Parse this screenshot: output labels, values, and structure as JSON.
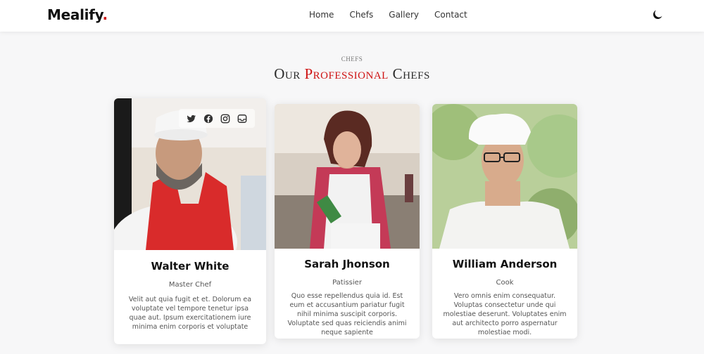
{
  "brand": {
    "name": "Mealify",
    "dot": "."
  },
  "nav": {
    "items": [
      "Home",
      "Chefs",
      "Gallery",
      "Contact"
    ]
  },
  "section": {
    "subtitle": "CHEFS",
    "title_part1": "Our ",
    "title_accent": "Professional",
    "title_part2": " Chefs"
  },
  "chefs": [
    {
      "name": "Walter White",
      "role": "Master Chef",
      "description": "Velit aut quia fugit et et. Dolorum ea voluptate vel tempore tenetur ipsa quae aut. Ipsum exercitationem iure minima enim corporis et voluptate"
    },
    {
      "name": "Sarah Jhonson",
      "role": "Patissier",
      "description": "Quo esse repellendus quia id. Est eum et accusantium pariatur fugit nihil minima suscipit corporis. Voluptate sed quas reiciendis animi neque sapiente"
    },
    {
      "name": "William Anderson",
      "role": "Cook",
      "description": "Vero omnis enim consequatur. Voluptas consectetur unde qui molestiae deserunt. Voluptates enim aut architecto porro aspernatur molestiae modi."
    }
  ],
  "social_icons": [
    "twitter-icon",
    "facebook-icon",
    "instagram-icon",
    "linkedin-icon"
  ],
  "colors": {
    "accent": "#ce1212",
    "background": "#f7f7f8"
  }
}
